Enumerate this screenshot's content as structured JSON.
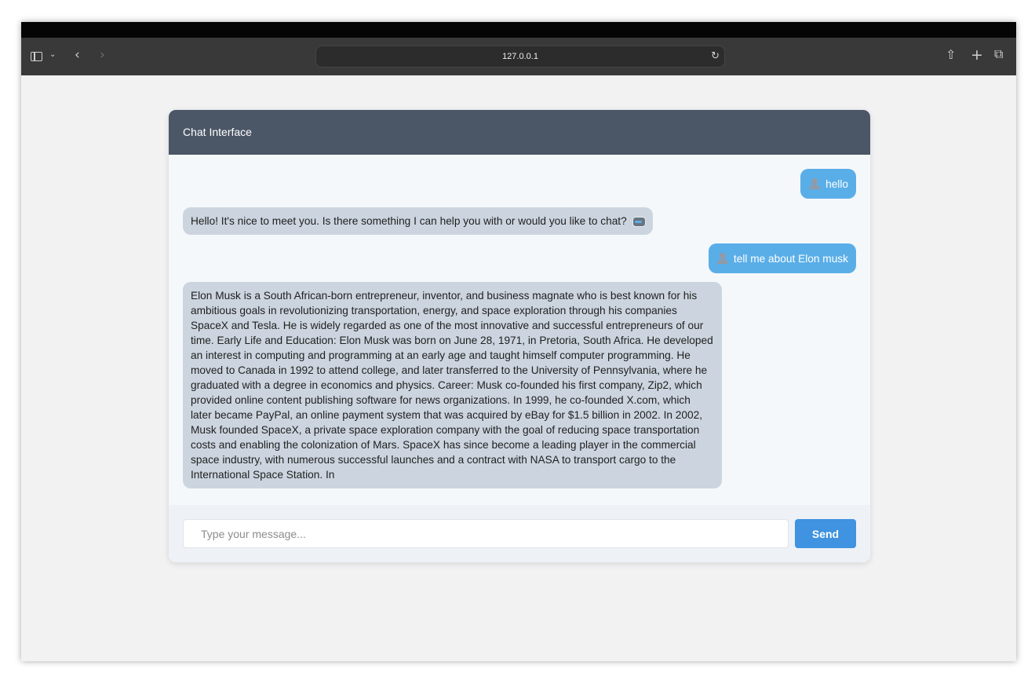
{
  "browser": {
    "url": "127.0.0.1"
  },
  "chat": {
    "title": "Chat Interface",
    "messages": [
      {
        "role": "user",
        "text": "hello"
      },
      {
        "role": "bot",
        "text": "Hello! It's nice to meet you. Is there something I can help you with or would you like to chat?"
      },
      {
        "role": "user",
        "text": "tell me about Elon musk"
      },
      {
        "role": "bot",
        "text": "Elon Musk is a South African-born entrepreneur, inventor, and business magnate who is best known for his ambitious goals in revolutionizing transportation, energy, and space exploration through his companies SpaceX and Tesla. He is widely regarded as one of the most innovative and successful entrepreneurs of our time. Early Life and Education: Elon Musk was born on June 28, 1971, in Pretoria, South Africa. He developed an interest in computing and programming at an early age and taught himself computer programming. He moved to Canada in 1992 to attend college, and later transferred to the University of Pennsylvania, where he graduated with a degree in economics and physics. Career: Musk co-founded his first company, Zip2, which provided online content publishing software for news organizations. In 1999, he co-founded X.com, which later became PayPal, an online payment system that was acquired by eBay for $1.5 billion in 2002. In 2002, Musk founded SpaceX, a private space exploration company with the goal of reducing space transportation costs and enabling the colonization of Mars. SpaceX has since become a leading player in the commercial space industry, with numerous successful launches and a contract with NASA to transport cargo to the International Space Station. In"
      }
    ],
    "input": {
      "value": "",
      "placeholder": "Type your message..."
    },
    "send_label": "Send"
  }
}
